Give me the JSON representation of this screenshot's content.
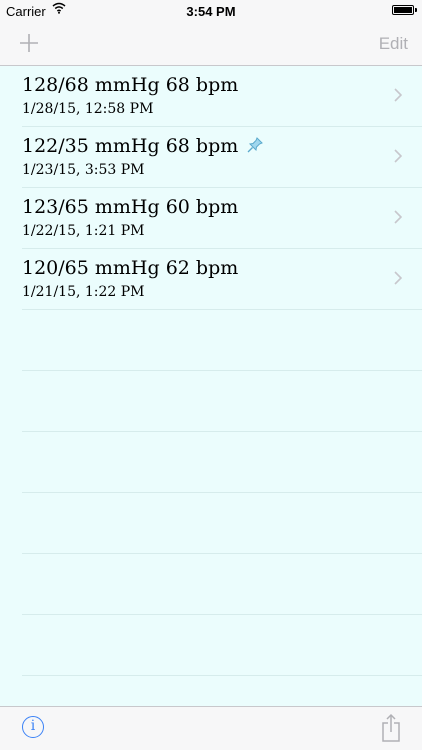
{
  "status_bar": {
    "carrier": "Carrier",
    "time": "3:54 PM"
  },
  "nav": {
    "edit_label": "Edit",
    "add_icon": "plus-icon"
  },
  "readings": [
    {
      "title": "128/68 mmHg 68 bpm",
      "date": "1/28/15, 12:58 PM",
      "pinned": false
    },
    {
      "title": "122/35 mmHg 68 bpm",
      "date": "1/23/15, 3:53 PM",
      "pinned": true
    },
    {
      "title": "123/65 mmHg 60 bpm",
      "date": "1/22/15, 1:21 PM",
      "pinned": false
    },
    {
      "title": "120/65 mmHg 62 bpm",
      "date": "1/21/15, 1:22 PM",
      "pinned": false
    }
  ],
  "toolbar": {
    "info_glyph": "i",
    "info_icon": "info-icon",
    "share_icon": "share-icon"
  },
  "colors": {
    "list_background": "#ebfdfd",
    "accent": "#3b82f6",
    "disabled": "#b0b0b5"
  }
}
